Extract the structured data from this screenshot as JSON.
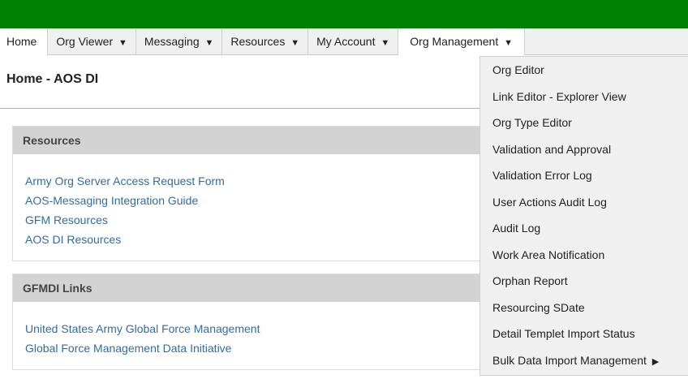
{
  "colors": {
    "topbar": "#008000",
    "link": "#2f6ca8",
    "panel_header": "#d3d3d3"
  },
  "nav": {
    "items": [
      {
        "label": "Home",
        "caret": ""
      },
      {
        "label": "Org Viewer",
        "caret": "▼"
      },
      {
        "label": "Messaging",
        "caret": "▼"
      },
      {
        "label": "Resources",
        "caret": "▼"
      },
      {
        "label": "My Account",
        "caret": "▼"
      },
      {
        "label": "Org Management",
        "caret": "▼"
      }
    ]
  },
  "page": {
    "title": "Home - AOS DI"
  },
  "panels": {
    "resources": {
      "header": "Resources",
      "links": [
        "Army Org Server Access Request Form",
        "AOS-Messaging Integration Guide",
        "GFM Resources",
        "AOS DI Resources"
      ]
    },
    "gfmdi": {
      "header": "GFMDI Links",
      "links": [
        "United States Army Global Force Management",
        "Global Force Management Data Initiative"
      ]
    }
  },
  "dropdown": {
    "items": [
      {
        "label": "Org Editor",
        "arrow": ""
      },
      {
        "label": "Link Editor - Explorer View",
        "arrow": ""
      },
      {
        "label": "Org Type Editor",
        "arrow": ""
      },
      {
        "label": "Validation and Approval",
        "arrow": ""
      },
      {
        "label": "Validation Error Log",
        "arrow": ""
      },
      {
        "label": "User Actions Audit Log",
        "arrow": ""
      },
      {
        "label": "Audit Log",
        "arrow": ""
      },
      {
        "label": "Work Area Notification",
        "arrow": ""
      },
      {
        "label": "Orphan Report",
        "arrow": ""
      },
      {
        "label": "Resourcing SDate",
        "arrow": ""
      },
      {
        "label": "Detail Templet Import Status",
        "arrow": ""
      },
      {
        "label": "Bulk Data Import Management",
        "arrow": "▶"
      }
    ]
  }
}
